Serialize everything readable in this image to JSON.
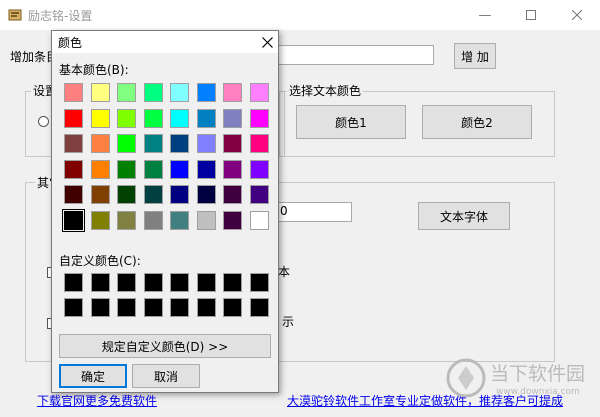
{
  "main_window": {
    "title": "励志铭-设置",
    "add_entry_label": "增加条目",
    "add_button": "增 加",
    "settings_group_title": "设置",
    "text_color_group_title": "选择文本颜色",
    "color1_button": "颜色1",
    "color2_button": "颜色2",
    "other_group_title": "其它",
    "number_field_value": "0",
    "font_button": "文本字体",
    "partial_label_1": "本",
    "partial_label_2": "示",
    "link_left": "下载官网更多免费软件",
    "link_right": "大漠驼铃软件工作室专业定做软件，推荐客户可提成",
    "watermark_text": "当下软件园",
    "watermark_url": "www.downxia.com"
  },
  "color_dialog": {
    "title": "颜色",
    "basic_colors_label": "基本颜色(B):",
    "custom_colors_label": "自定义颜色(C):",
    "define_custom_button": "规定自定义颜色(D) >>",
    "ok_button": "确定",
    "cancel_button": "取消",
    "selected_basic_index": 40,
    "basic_colors": [
      "#ff8080",
      "#ffff80",
      "#80ff80",
      "#00ff80",
      "#80ffff",
      "#0080ff",
      "#ff80c0",
      "#ff80ff",
      "#ff0000",
      "#ffff00",
      "#80ff00",
      "#00ff40",
      "#00ffff",
      "#0080c0",
      "#8080c0",
      "#ff00ff",
      "#804040",
      "#ff8040",
      "#00ff00",
      "#008080",
      "#004080",
      "#8080ff",
      "#800040",
      "#ff0080",
      "#800000",
      "#ff8000",
      "#008000",
      "#008040",
      "#0000ff",
      "#0000a0",
      "#800080",
      "#8000ff",
      "#400000",
      "#804000",
      "#004000",
      "#004040",
      "#000080",
      "#000040",
      "#400040",
      "#400080",
      "#000000",
      "#808000",
      "#808040",
      "#808080",
      "#408080",
      "#c0c0c0",
      "#400040",
      "#ffffff"
    ],
    "custom_colors": [
      "#000000",
      "#000000",
      "#000000",
      "#000000",
      "#000000",
      "#000000",
      "#000000",
      "#000000",
      "#000000",
      "#000000",
      "#000000",
      "#000000",
      "#000000",
      "#000000",
      "#000000",
      "#000000"
    ]
  }
}
